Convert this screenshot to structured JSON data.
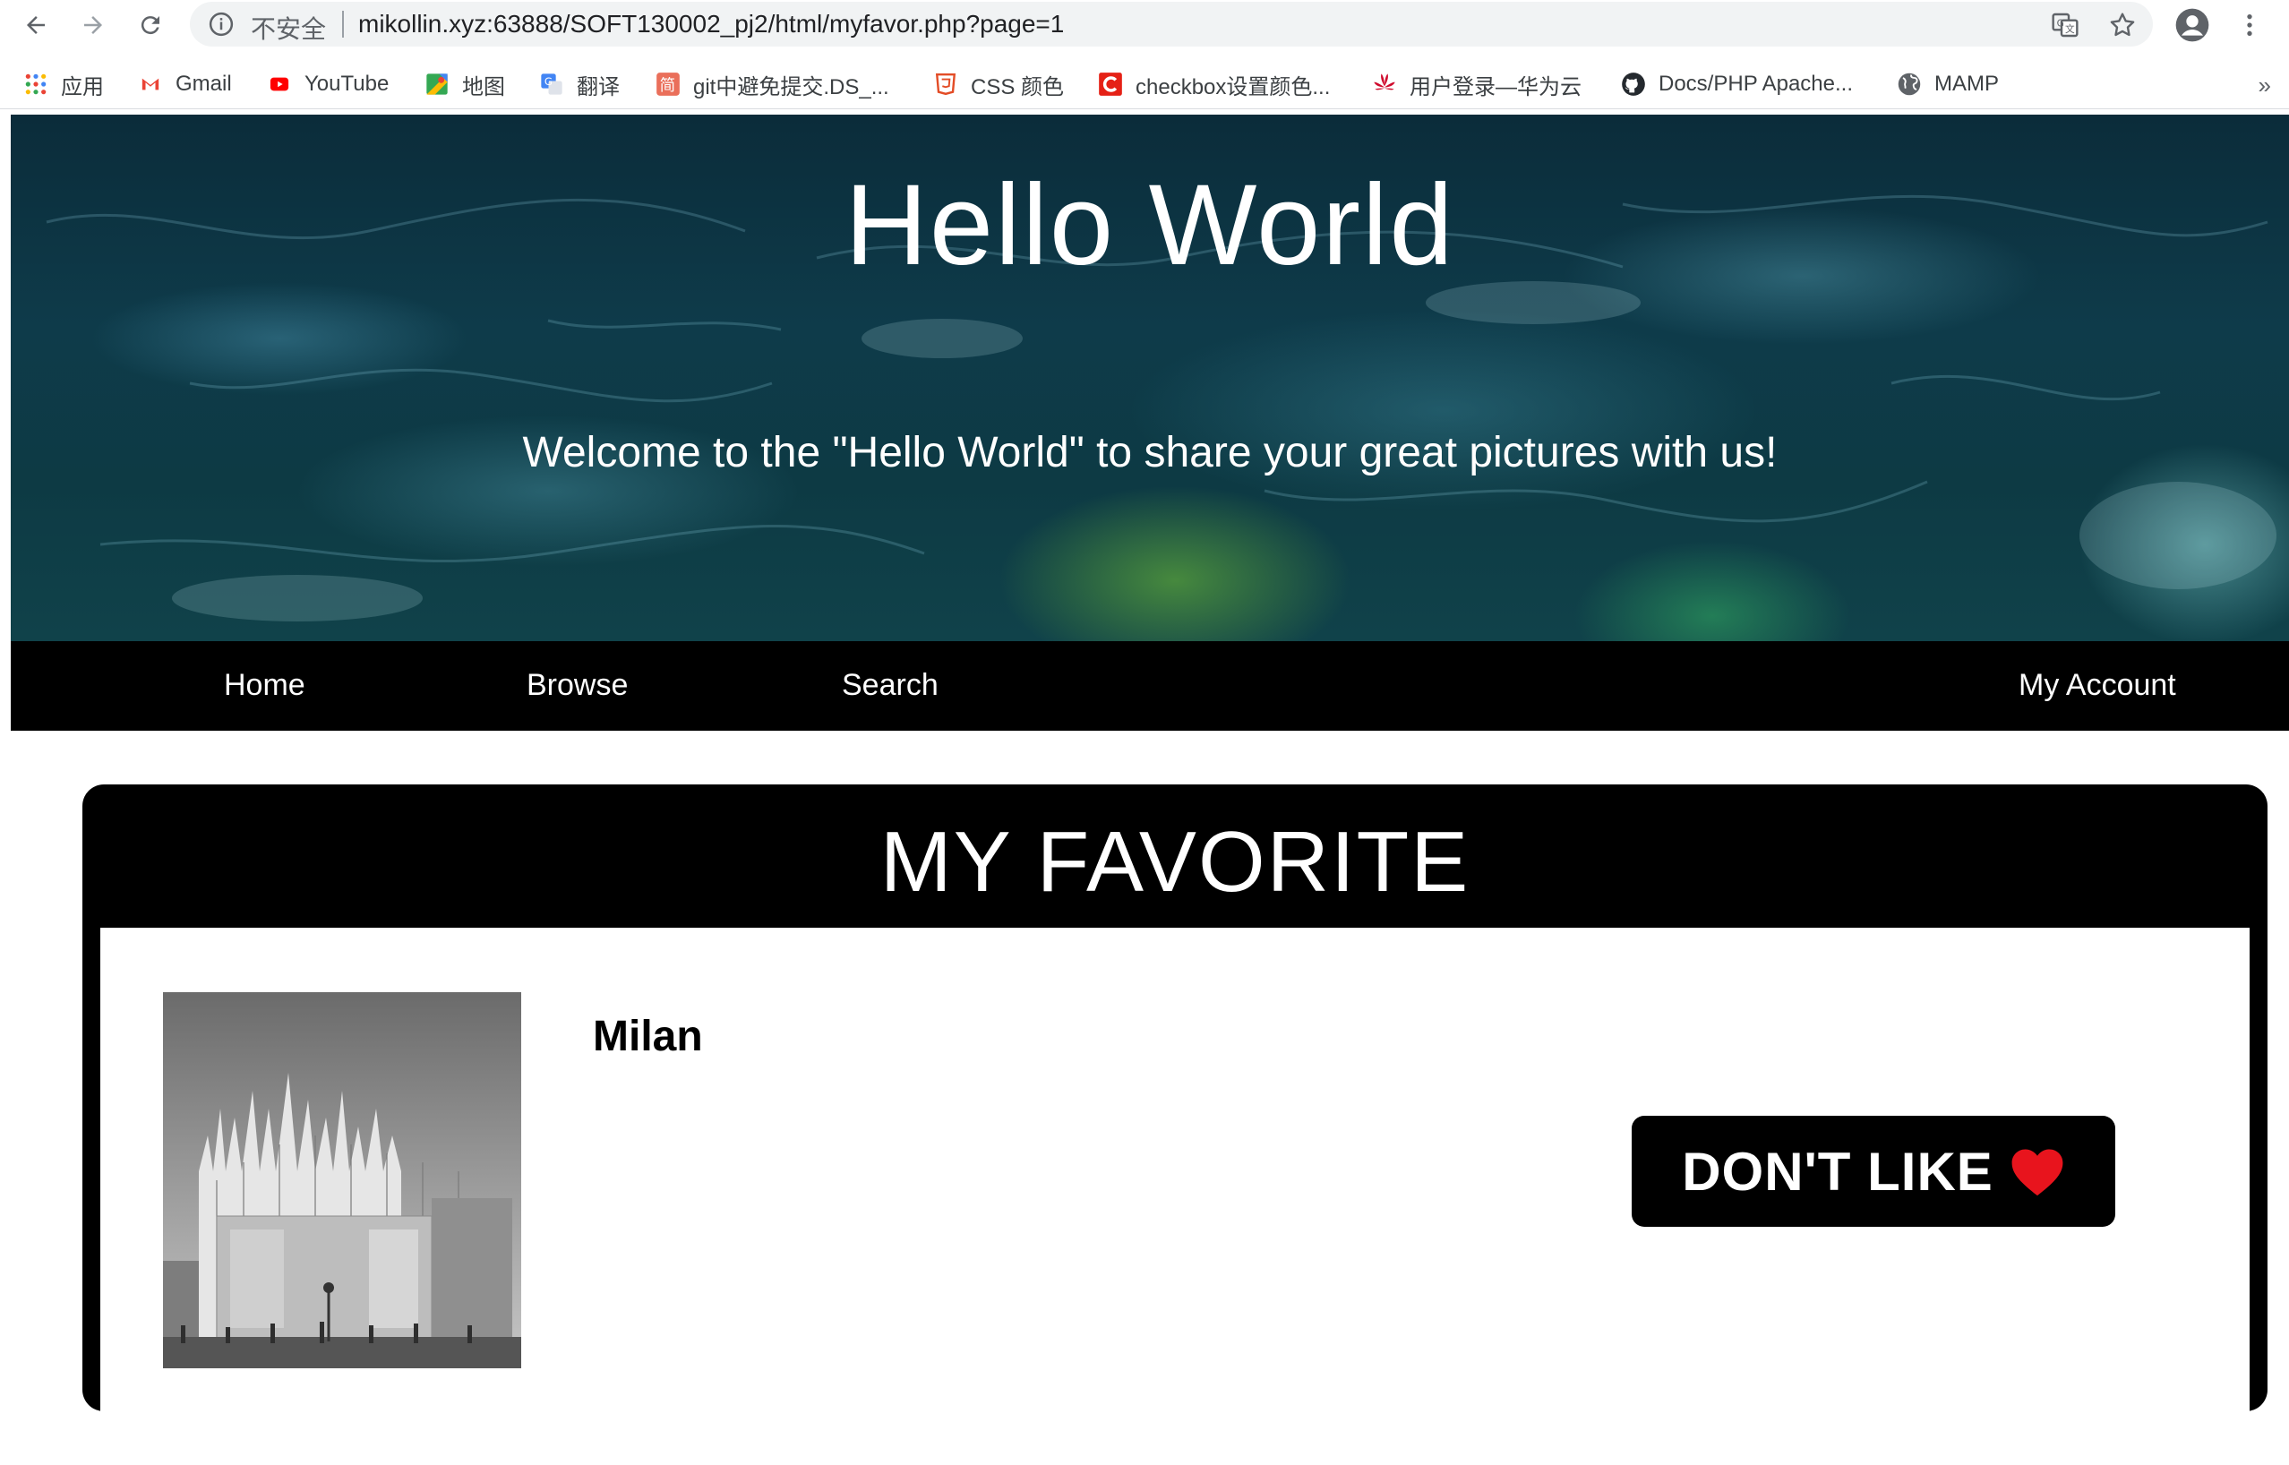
{
  "browser": {
    "url_security": "不安全",
    "url": "mikollin.xyz:63888/SOFT130002_pj2/html/myfavor.php?page=1",
    "bookmarks": [
      {
        "label": "应用",
        "icon": "apps-grid-icon"
      },
      {
        "label": "Gmail",
        "icon": "gmail-icon"
      },
      {
        "label": "YouTube",
        "icon": "youtube-icon"
      },
      {
        "label": "地图",
        "icon": "maps-icon"
      },
      {
        "label": "翻译",
        "icon": "translate-icon"
      },
      {
        "label": "git中避免提交.DS_...",
        "icon": "jianshu-icon"
      },
      {
        "label": "CSS 颜色",
        "icon": "html-shield-icon"
      },
      {
        "label": "checkbox设置颜色...",
        "icon": "csdn-icon"
      },
      {
        "label": "用户登录—华为云",
        "icon": "huawei-icon"
      },
      {
        "label": "Docs/PHP Apache...",
        "icon": "github-icon"
      },
      {
        "label": "MAMP",
        "icon": "globe-icon"
      }
    ],
    "more": "»"
  },
  "hero": {
    "title": "Hello World",
    "subtitle": "Welcome to the \"Hello World\" to share your great pictures with us!"
  },
  "nav": {
    "home": "Home",
    "browse": "Browse",
    "search": "Search",
    "account": "My Account"
  },
  "favorites": {
    "heading": "MY FAVORITE",
    "items": [
      {
        "title": "Milan",
        "button": "DON'T LIKE",
        "heart_color": "#e8141d"
      }
    ]
  }
}
